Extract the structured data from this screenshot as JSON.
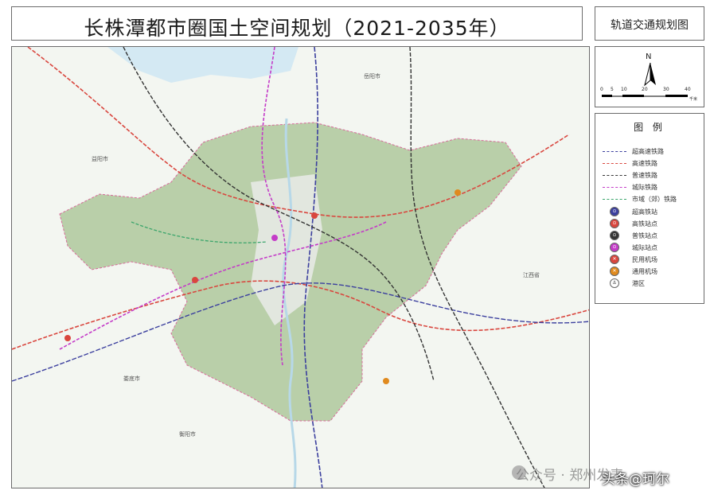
{
  "title": "长株潭都市圈国土空间规划（2021-2035年）",
  "subtitle": "轨道交通规划图",
  "north_label": "N",
  "scale": {
    "ticks": [
      "0",
      "5",
      "10",
      "20",
      "30",
      "40"
    ],
    "unit": "千米"
  },
  "legend": {
    "title": "图 例",
    "lines": [
      {
        "label": "超高速铁路",
        "color": "#3b3f9e"
      },
      {
        "label": "高速铁路",
        "color": "#d9463e"
      },
      {
        "label": "普速铁路",
        "color": "#333333"
      },
      {
        "label": "城际铁路",
        "color": "#c43cc8"
      },
      {
        "label": "市域（郊）铁路",
        "color": "#3aa56b"
      }
    ],
    "stations": [
      {
        "label": "超高铁站",
        "color": "#3b3f9e",
        "glyph": "train-icon"
      },
      {
        "label": "高铁站点",
        "color": "#d9463e",
        "glyph": "train-icon"
      },
      {
        "label": "普铁站点",
        "color": "#333333",
        "glyph": "train-icon"
      },
      {
        "label": "城际站点",
        "color": "#c43cc8",
        "glyph": "train-icon"
      },
      {
        "label": "民用机场",
        "color": "#d9463e",
        "glyph": "plane-icon"
      },
      {
        "label": "通用机场",
        "color": "#e08a1e",
        "glyph": "plane-icon"
      },
      {
        "label": "港区",
        "color": "#555555",
        "glyph": "anchor-icon"
      }
    ]
  },
  "map_labels": {
    "yueyang": "岳阳市",
    "yiyang": "益阳市",
    "loudi": "娄底市",
    "hengyang": "衡阳市",
    "jiangxi": "江西省"
  },
  "watermark": {
    "platform": "公众号 · 郑州发表",
    "source": "头条@珂尔"
  }
}
